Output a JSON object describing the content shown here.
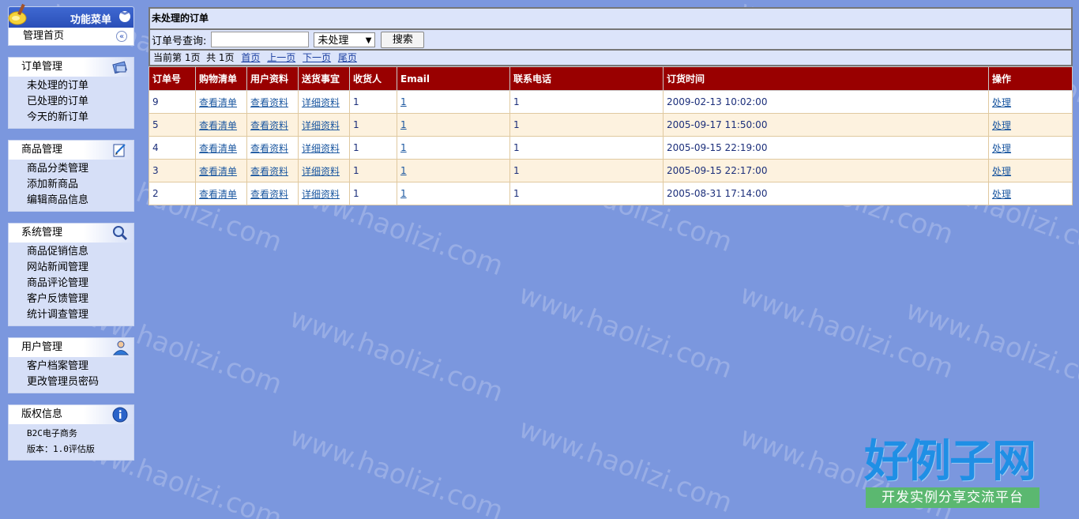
{
  "sidebar": {
    "menu_title": "功能菜单",
    "home": "管理首页",
    "groups": [
      {
        "title": "订单管理",
        "icon": "orders-icon",
        "items": [
          "未处理的订单",
          "已处理的订单",
          "今天的新订单"
        ]
      },
      {
        "title": "商品管理",
        "icon": "edit-icon",
        "items": [
          "商品分类管理",
          "添加新商品",
          "编辑商品信息"
        ]
      },
      {
        "title": "系统管理",
        "icon": "magnifier-icon",
        "items": [
          "商品促销信息",
          "网站新闻管理",
          "商品评论管理",
          "客户反馈管理",
          "统计调查管理"
        ]
      },
      {
        "title": "用户管理",
        "icon": "user-icon",
        "items": [
          "客户档案管理",
          "更改管理员密码"
        ]
      },
      {
        "title": "版权信息",
        "icon": "info-icon",
        "items": [
          "B2C电子商务",
          "版本：1.0评估版"
        ]
      }
    ]
  },
  "main": {
    "title": "未处理的订单",
    "search": {
      "label": "订单号查询:",
      "value": "",
      "status_selected": "未处理",
      "button": "搜索"
    },
    "pager": {
      "info": "当前第 1页  共 1页",
      "first": "首页",
      "prev": "上一页",
      "next": "下一页",
      "last": "尾页"
    },
    "columns": [
      "订单号",
      "购物清单",
      "用户资料",
      "送货事宜",
      "收货人",
      "Email",
      "联系电话",
      "订货时间",
      "操作"
    ],
    "rows": [
      {
        "id": "9",
        "cart": "查看清单",
        "profile": "查看资料",
        "ship": "详细资料",
        "receiver": "1",
        "email": "1",
        "phone": "1",
        "time": "2009-02-13 10:02:00",
        "action": "处理"
      },
      {
        "id": "5",
        "cart": "查看清单",
        "profile": "查看资料",
        "ship": "详细资料",
        "receiver": "1",
        "email": "1",
        "phone": "1",
        "time": "2005-09-17 11:50:00",
        "action": "处理"
      },
      {
        "id": "4",
        "cart": "查看清单",
        "profile": "查看资料",
        "ship": "详细资料",
        "receiver": "1",
        "email": "1",
        "phone": "1",
        "time": "2005-09-15 22:19:00",
        "action": "处理"
      },
      {
        "id": "3",
        "cart": "查看清单",
        "profile": "查看资料",
        "ship": "详细资料",
        "receiver": "1",
        "email": "1",
        "phone": "1",
        "time": "2005-09-15 22:17:00",
        "action": "处理"
      },
      {
        "id": "2",
        "cart": "查看清单",
        "profile": "查看资料",
        "ship": "详细资料",
        "receiver": "1",
        "email": "1",
        "phone": "1",
        "time": "2005-08-31 17:14:00",
        "action": "处理"
      }
    ]
  },
  "brand": {
    "big": "好例子网",
    "sub": "开发实例分享交流平台"
  },
  "watermark": "www.haolizi.com"
}
